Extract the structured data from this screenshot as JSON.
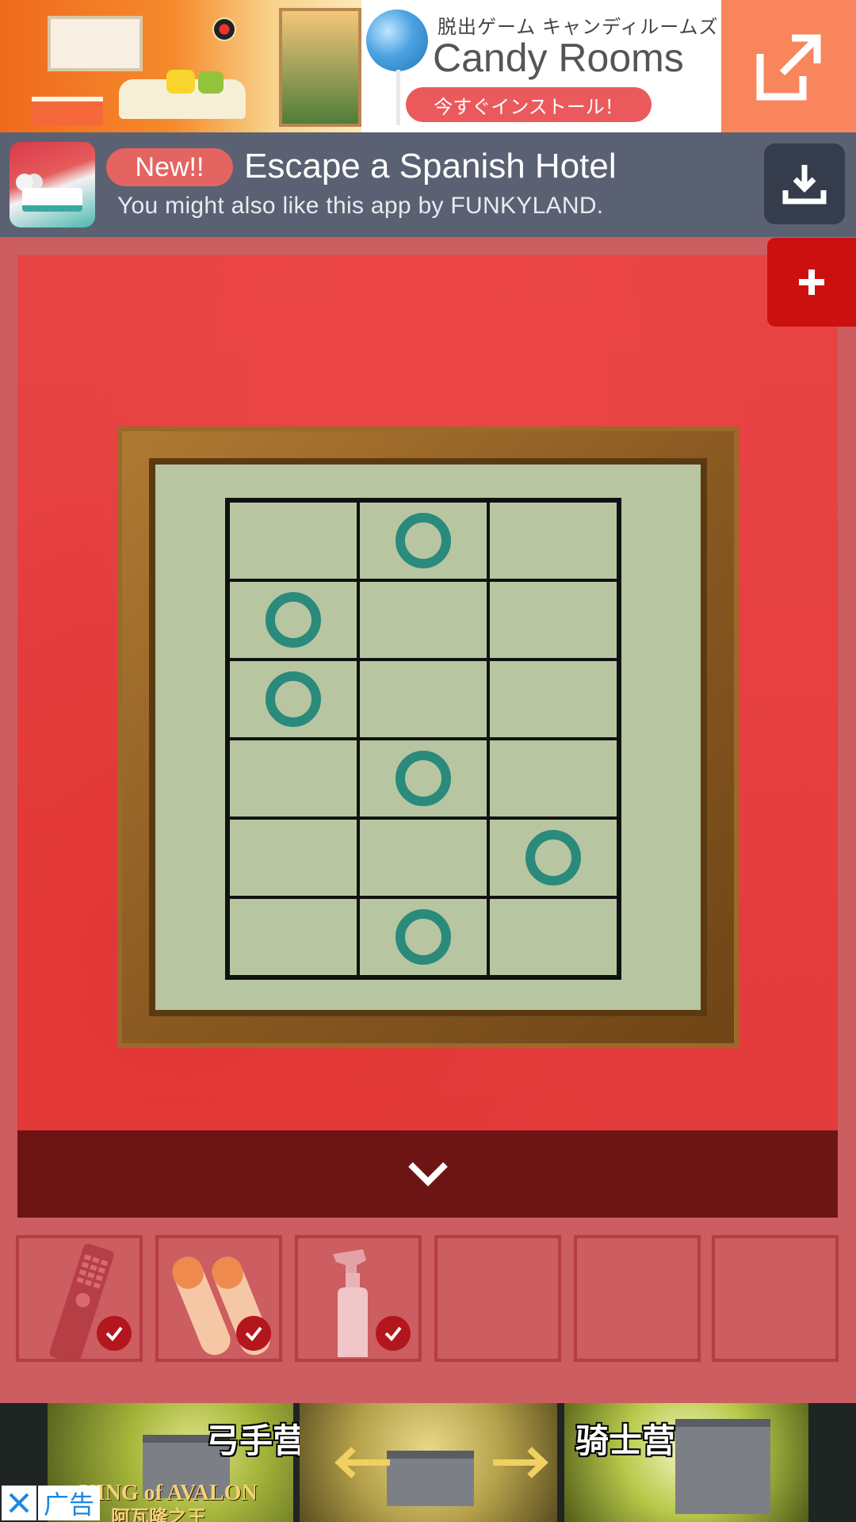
{
  "top_ad": {
    "subtitle_jp": "脱出ゲーム キャンディルームズ",
    "title": "Candy Rooms",
    "install_label": "今すぐインストール！",
    "open_icon": "external-link-icon"
  },
  "promo": {
    "badge": "New!!",
    "title": "Escape a Spanish Hotel",
    "subtitle": "You might also like this app by FUNKYLAND.",
    "download_icon": "download-icon"
  },
  "game": {
    "grid": {
      "rows": 6,
      "cols": 3,
      "circles": [
        [
          0,
          1
        ],
        [
          1,
          0
        ],
        [
          2,
          0
        ],
        [
          3,
          1
        ],
        [
          4,
          2
        ],
        [
          5,
          1
        ]
      ],
      "circle_color": "#2a8a7c"
    },
    "plus_icon": "plus-icon",
    "collapse_icon": "chevron-down-icon"
  },
  "inventory": {
    "slots": [
      {
        "item": "remote-control",
        "checked": true
      },
      {
        "item": "batteries",
        "checked": true
      },
      {
        "item": "spray-bottle",
        "checked": true
      },
      {
        "item": "",
        "checked": false
      },
      {
        "item": "",
        "checked": false
      },
      {
        "item": "",
        "checked": false
      }
    ]
  },
  "bottom_ad": {
    "label_left": "弓手营",
    "label_right": "骑士营",
    "logo": "KING of AVALON",
    "logo_cn": "阿瓦隆之王",
    "ad_tag": "广告",
    "close_icon": "close-icon"
  },
  "colors": {
    "background": "#cc5d60",
    "scene_red": "#e84444",
    "collapse_bar": "#6d1515",
    "plus_button": "#cc1010",
    "promo_bar": "#5a6172"
  }
}
